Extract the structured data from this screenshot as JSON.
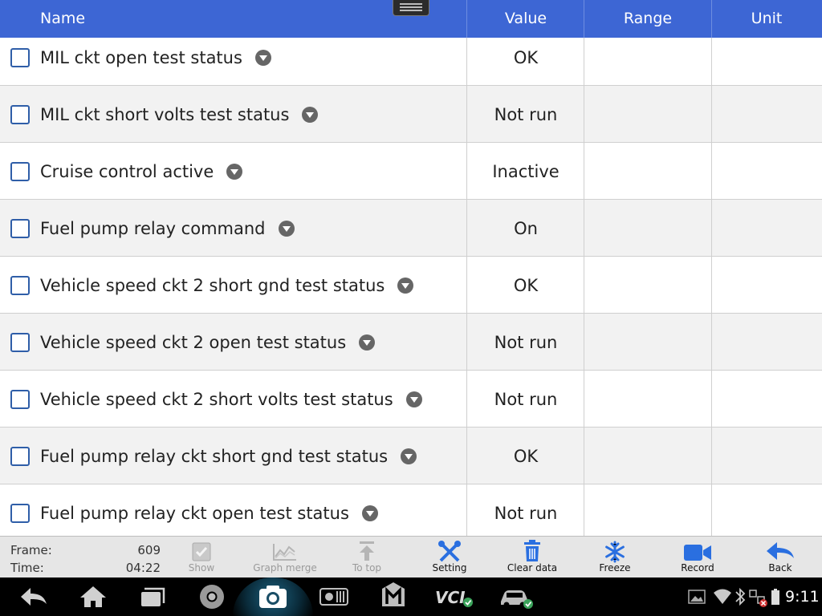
{
  "header": {
    "name": "Name",
    "value": "Value",
    "range": "Range",
    "unit": "Unit"
  },
  "rows": [
    {
      "name": "MIL ckt open test status",
      "value": "OK",
      "range": "",
      "unit": ""
    },
    {
      "name": "MIL ckt short volts test status",
      "value": "Not run",
      "range": "",
      "unit": ""
    },
    {
      "name": "Cruise control active",
      "value": "Inactive",
      "range": "",
      "unit": ""
    },
    {
      "name": "Fuel pump relay command",
      "value": "On",
      "range": "",
      "unit": ""
    },
    {
      "name": "Vehicle speed ckt 2 short gnd test status",
      "value": "OK",
      "range": "",
      "unit": ""
    },
    {
      "name": "Vehicle speed ckt 2 open test status",
      "value": "Not run",
      "range": "",
      "unit": ""
    },
    {
      "name": "Vehicle speed ckt 2 short volts test status",
      "value": "Not run",
      "range": "",
      "unit": ""
    },
    {
      "name": "Fuel pump relay ckt short gnd test status",
      "value": "OK",
      "range": "",
      "unit": ""
    },
    {
      "name": "Fuel pump relay ckt open test status",
      "value": "Not run",
      "range": "",
      "unit": ""
    }
  ],
  "toolbar": {
    "frame_label": "Frame:",
    "frame_value": "609",
    "time_label": "Time:",
    "time_value": "04:22",
    "show": "Show",
    "graph_merge": "Graph merge",
    "to_top": "To top",
    "setting": "Setting",
    "clear_data": "Clear data",
    "freeze": "Freeze",
    "record": "Record",
    "back": "Back"
  },
  "statusbar": {
    "clock": "9:11"
  },
  "colors": {
    "header": "#3d66d4",
    "accent_icon": "#2a6fe0"
  }
}
